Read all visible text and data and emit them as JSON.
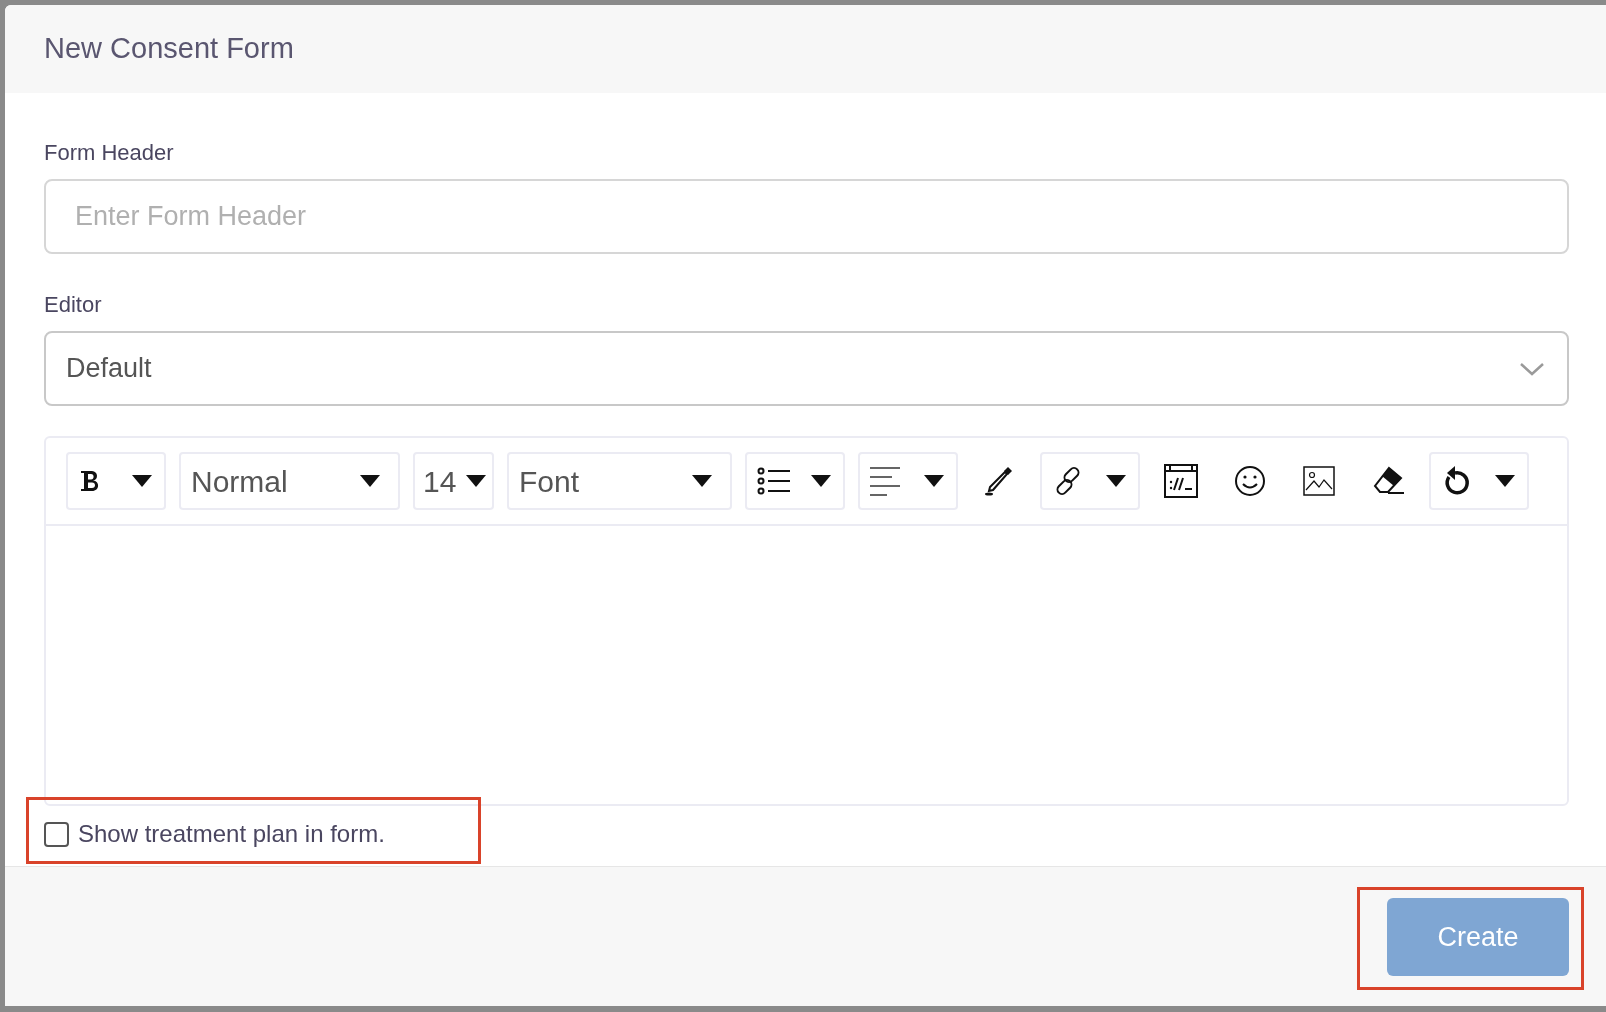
{
  "dialog": {
    "title": "New Consent Form"
  },
  "form_header": {
    "label": "Form Header",
    "placeholder": "Enter Form Header"
  },
  "editor_select": {
    "label": "Editor",
    "value": "Default"
  },
  "toolbar": [
    {
      "kind": "bold",
      "dropdown": true
    },
    {
      "kind": "select",
      "label": "Normal"
    },
    {
      "kind": "select",
      "label": "14"
    },
    {
      "kind": "select",
      "label": "Font"
    },
    {
      "kind": "list",
      "dropdown": true
    },
    {
      "kind": "align",
      "dropdown": true
    },
    {
      "kind": "color",
      "dropdown": false
    },
    {
      "kind": "link",
      "dropdown": true
    },
    {
      "kind": "code",
      "dropdown": false
    },
    {
      "kind": "emoji",
      "dropdown": false
    },
    {
      "kind": "image",
      "dropdown": false
    },
    {
      "kind": "eraser",
      "dropdown": false
    },
    {
      "kind": "undo",
      "dropdown": true
    }
  ],
  "checkbox": {
    "label": "Show treatment plan in form.",
    "checked": false
  },
  "create_button": {
    "label": "Create",
    "disabled": true
  },
  "annotations": [
    {
      "kind": "highlight",
      "color": "#d9432a"
    },
    {
      "kind": "highlight",
      "color": "#d9432a"
    }
  ]
}
